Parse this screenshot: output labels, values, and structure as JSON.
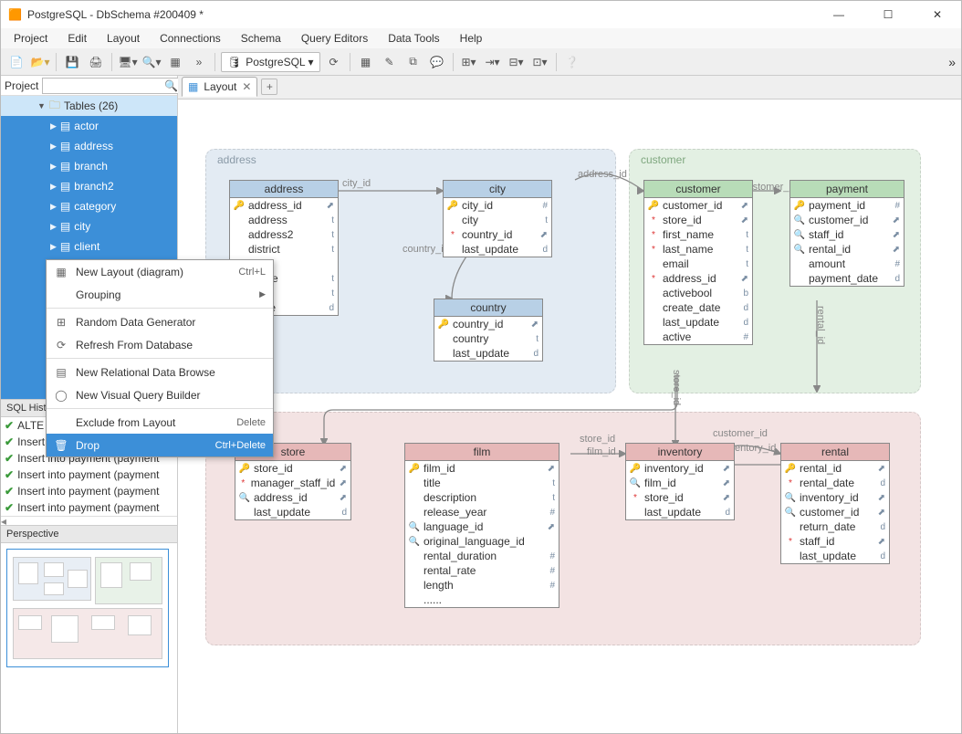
{
  "window_title": "PostgreSQL - DbSchema #200409 *",
  "menu": [
    "Project",
    "Edit",
    "Layout",
    "Connections",
    "Schema",
    "Query Editors",
    "Data Tools",
    "Help"
  ],
  "db_selector": "PostgreSQL ▾",
  "project_label": "Project",
  "tree_root": "Tables (26)",
  "tree_items": [
    "actor",
    "address",
    "branch",
    "branch2",
    "category",
    "city",
    "client"
  ],
  "context_menu": {
    "new_layout": "New Layout (diagram)",
    "new_layout_accel": "Ctrl+L",
    "grouping": "Grouping",
    "random_data": "Random Data Generator",
    "refresh": "Refresh From Database",
    "new_relational": "New Relational Data Browse",
    "new_visual": "New Visual Query Builder",
    "exclude": "Exclude from Layout",
    "exclude_accel": "Delete",
    "drop": "Drop",
    "drop_accel": "Ctrl+Delete"
  },
  "sql_history_label": "SQL Hist",
  "history": [
    "ALTE",
    "Insert into payment (payment",
    "Insert into payment (payment",
    "Insert into payment (payment",
    "Insert into payment (payment",
    "Insert into payment (payment"
  ],
  "perspective_label": "Perspective",
  "tab_label": "Layout",
  "groups": {
    "address": "address",
    "customer": "customer"
  },
  "rel_labels": {
    "city_id": "city_id",
    "country_id": "country_id",
    "address_id": "address_id",
    "customer_id": "customer_id",
    "rental_id": "rental_id",
    "store_id": "store_id",
    "film_id": "film_id",
    "customer_id2": "customer_id",
    "inventory_id": "inventory_id"
  },
  "tables": {
    "address": {
      "title": "address",
      "cols": [
        {
          "i": "k",
          "n": "address_id",
          "t": "⬈"
        },
        {
          "i": "",
          "n": "address",
          "t": "t"
        },
        {
          "i": "",
          "n": "address2",
          "t": "t"
        },
        {
          "i": "",
          "n": "district",
          "t": "t"
        },
        {
          "i": "*",
          "n": "",
          "t": ""
        },
        {
          "i": "",
          "n": "_code",
          "t": "t"
        },
        {
          "i": "",
          "n": "",
          "t": "t"
        },
        {
          "i": "",
          "n": "pdate",
          "t": "d"
        }
      ]
    },
    "city": {
      "title": "city",
      "cols": [
        {
          "i": "k",
          "n": "city_id",
          "t": "#"
        },
        {
          "i": "",
          "n": "city",
          "t": "t"
        },
        {
          "i": "*",
          "n": "country_id",
          "t": "⬈"
        },
        {
          "i": "",
          "n": "last_update",
          "t": "d"
        }
      ]
    },
    "country": {
      "title": "country",
      "cols": [
        {
          "i": "k",
          "n": "country_id",
          "t": "⬈"
        },
        {
          "i": "",
          "n": "country",
          "t": "t"
        },
        {
          "i": "",
          "n": "last_update",
          "t": "d"
        }
      ]
    },
    "customer": {
      "title": "customer",
      "cols": [
        {
          "i": "k",
          "n": "customer_id",
          "t": "⬈"
        },
        {
          "i": "*",
          "n": "store_id",
          "t": "⬈"
        },
        {
          "i": "*",
          "n": "first_name",
          "t": "t"
        },
        {
          "i": "*",
          "n": "last_name",
          "t": "t"
        },
        {
          "i": "",
          "n": "email",
          "t": "t"
        },
        {
          "i": "*",
          "n": "address_id",
          "t": "⬈"
        },
        {
          "i": "",
          "n": "activebool",
          "t": "b"
        },
        {
          "i": "",
          "n": "create_date",
          "t": "d"
        },
        {
          "i": "",
          "n": "last_update",
          "t": "d"
        },
        {
          "i": "",
          "n": "active",
          "t": "#"
        }
      ]
    },
    "payment": {
      "title": "payment",
      "cols": [
        {
          "i": "k",
          "n": "payment_id",
          "t": "#"
        },
        {
          "i": "s",
          "n": "customer_id",
          "t": "⬈"
        },
        {
          "i": "s",
          "n": "staff_id",
          "t": "⬈"
        },
        {
          "i": "s",
          "n": "rental_id",
          "t": "⬈"
        },
        {
          "i": "",
          "n": "amount",
          "t": "#"
        },
        {
          "i": "",
          "n": "payment_date",
          "t": "d"
        }
      ]
    },
    "store": {
      "title": "store",
      "cols": [
        {
          "i": "k",
          "n": "store_id",
          "t": "⬈"
        },
        {
          "i": "*",
          "n": "manager_staff_id",
          "t": "⬈"
        },
        {
          "i": "s",
          "n": "address_id",
          "t": "⬈"
        },
        {
          "i": "",
          "n": "last_update",
          "t": "d"
        }
      ]
    },
    "film": {
      "title": "film",
      "cols": [
        {
          "i": "k",
          "n": "film_id",
          "t": "⬈"
        },
        {
          "i": "",
          "n": "title",
          "t": "t"
        },
        {
          "i": "",
          "n": "description",
          "t": "t"
        },
        {
          "i": "",
          "n": "release_year",
          "t": "#"
        },
        {
          "i": "s",
          "n": "language_id",
          "t": "⬈"
        },
        {
          "i": "s",
          "n": "original_language_id",
          "t": ""
        },
        {
          "i": "",
          "n": "rental_duration",
          "t": "#"
        },
        {
          "i": "",
          "n": "rental_rate",
          "t": "#"
        },
        {
          "i": "",
          "n": "length",
          "t": "#"
        },
        {
          "i": "",
          "n": "......",
          "t": ""
        }
      ]
    },
    "inventory": {
      "title": "inventory",
      "cols": [
        {
          "i": "k",
          "n": "inventory_id",
          "t": "⬈"
        },
        {
          "i": "s",
          "n": "film_id",
          "t": "⬈"
        },
        {
          "i": "*",
          "n": "store_id",
          "t": "⬈"
        },
        {
          "i": "",
          "n": "last_update",
          "t": "d"
        }
      ]
    },
    "rental": {
      "title": "rental",
      "cols": [
        {
          "i": "k",
          "n": "rental_id",
          "t": "⬈"
        },
        {
          "i": "*",
          "n": "rental_date",
          "t": "d"
        },
        {
          "i": "s",
          "n": "inventory_id",
          "t": "⬈"
        },
        {
          "i": "s",
          "n": "customer_id",
          "t": "⬈"
        },
        {
          "i": "",
          "n": "return_date",
          "t": "d"
        },
        {
          "i": "*",
          "n": "staff_id",
          "t": "⬈"
        },
        {
          "i": "",
          "n": "last_update",
          "t": "d"
        }
      ]
    }
  }
}
